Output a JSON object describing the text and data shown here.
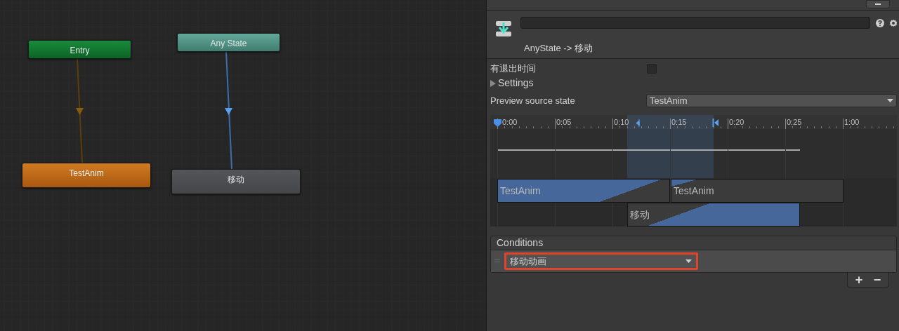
{
  "graph": {
    "nodes": [
      {
        "label": "Entry",
        "kind": "entry"
      },
      {
        "label": "Any State",
        "kind": "any"
      },
      {
        "label": "TestAnim",
        "kind": "default"
      },
      {
        "label": "移动",
        "kind": "state"
      }
    ]
  },
  "inspector": {
    "title": "AnyState -> 移动",
    "exit_time": {
      "label": "有退出时间",
      "checked": false
    },
    "settings": {
      "label": "Settings",
      "expanded": false
    },
    "preview": {
      "label": "Preview source state",
      "value": "TestAnim"
    },
    "timeline": {
      "ticks": [
        "0:00",
        "0:05",
        "0:10",
        "0:15",
        "0:20",
        "0:25",
        "1:00"
      ],
      "clips": [
        {
          "label": "TestAnim"
        },
        {
          "label": "TestAnim"
        },
        {
          "label": "移动"
        }
      ]
    },
    "conditions": {
      "title": "Conditions",
      "items": [
        {
          "value": "移动动画",
          "highlighted": true
        }
      ],
      "buttons": [
        "+",
        "−"
      ]
    }
  }
}
